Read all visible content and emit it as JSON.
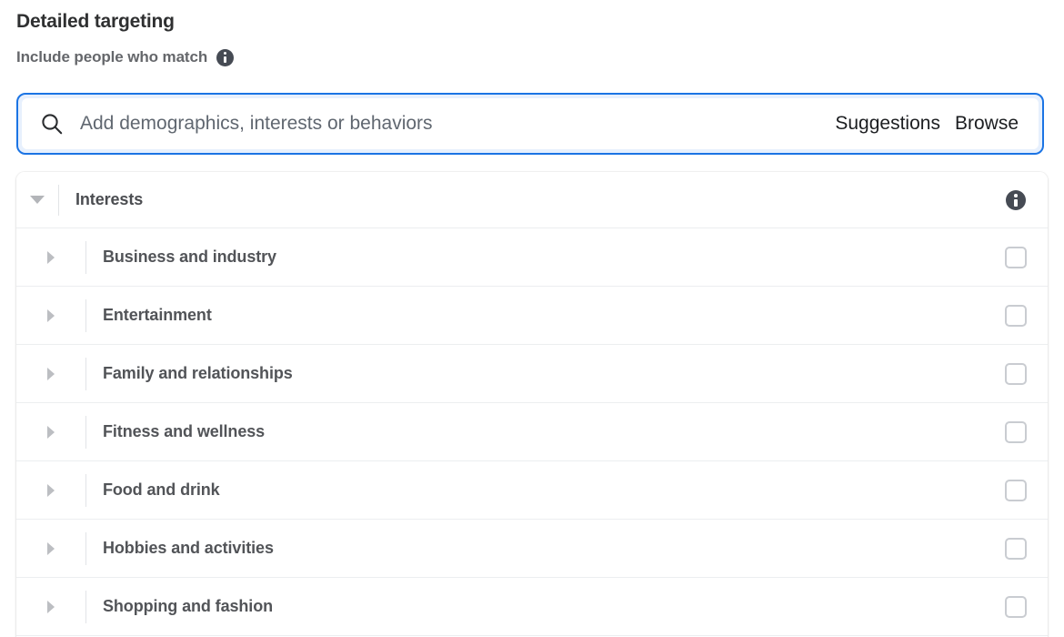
{
  "header": {
    "title": "Detailed targeting",
    "subtitle": "Include people who match",
    "info_icon": "info-icon"
  },
  "search": {
    "icon": "search-icon",
    "value": "",
    "placeholder": "Add demographics, interests or behaviors",
    "actions": [
      {
        "label": "Suggestions",
        "name": "suggestions-button"
      },
      {
        "label": "Browse",
        "name": "browse-button"
      }
    ]
  },
  "panel": {
    "group": {
      "label": "Interests",
      "expanded": true,
      "toggle_icon": "chevron-down-icon",
      "info_icon": "info-icon"
    },
    "items": [
      {
        "label": "Business and industry",
        "toggle_icon": "chevron-right-icon",
        "checked": false
      },
      {
        "label": "Entertainment",
        "toggle_icon": "chevron-right-icon",
        "checked": false
      },
      {
        "label": "Family and relationships",
        "toggle_icon": "chevron-right-icon",
        "checked": false
      },
      {
        "label": "Fitness and wellness",
        "toggle_icon": "chevron-right-icon",
        "checked": false
      },
      {
        "label": "Food and drink",
        "toggle_icon": "chevron-right-icon",
        "checked": false
      },
      {
        "label": "Hobbies and activities",
        "toggle_icon": "chevron-right-icon",
        "checked": false
      },
      {
        "label": "Shopping and fashion",
        "toggle_icon": "chevron-right-icon",
        "checked": false
      }
    ]
  },
  "colors": {
    "focus_blue": "#1b74e4",
    "focus_halo": "#e7f0fd",
    "title_text": "#2f3031",
    "muted_text": "#65676b",
    "row_text": "#525458",
    "separator": "#eceef0",
    "checkbox_border": "#c9ccd1",
    "info_badge": "#464b54"
  }
}
